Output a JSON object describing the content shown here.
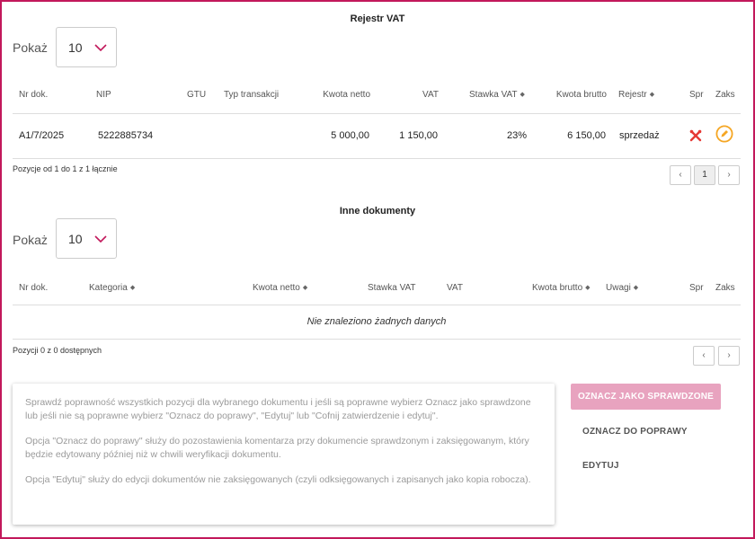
{
  "vat_section": {
    "title": "Rejestr VAT",
    "show_label": "Pokaż",
    "page_size": "10",
    "headers": {
      "nr_dok": "Nr dok.",
      "nip": "NIP",
      "gtu": "GTU",
      "typ_transakcji": "Typ transakcji",
      "kwota_netto": "Kwota netto",
      "vat": "VAT",
      "stawka_vat": "Stawka VAT",
      "kwota_brutto": "Kwota brutto",
      "rejestr": "Rejestr",
      "spr": "Spr",
      "zaks": "Zaks"
    },
    "rows": [
      {
        "nr_dok": "A1/7/2025",
        "nip": "5222885734",
        "gtu": "",
        "typ_transakcji": "",
        "kwota_netto": "5 000,00",
        "vat": "1 150,00",
        "stawka_vat": "23%",
        "kwota_brutto": "6 150,00",
        "rejestr": "sprzedaż"
      }
    ],
    "info": "Pozycje od 1 do 1 z 1 łącznie",
    "pagination": {
      "prev": "‹",
      "current": "1",
      "next": "›"
    }
  },
  "other_section": {
    "title": "Inne dokumenty",
    "show_label": "Pokaż",
    "page_size": "10",
    "headers": {
      "nr_dok": "Nr dok.",
      "kategoria": "Kategoria",
      "kwota_netto": "Kwota netto",
      "stawka_vat": "Stawka VAT",
      "vat": "VAT",
      "kwota_brutto": "Kwota brutto",
      "uwagi": "Uwagi",
      "spr": "Spr",
      "zaks": "Zaks"
    },
    "empty_text": "Nie znaleziono żadnych danych",
    "info": "Pozycji 0 z 0 dostępnych",
    "pagination": {
      "prev": "‹",
      "next": "›"
    }
  },
  "note": {
    "p1": "Sprawdź poprawność wszystkich pozycji dla wybranego dokumentu i jeśli są poprawne wybierz Oznacz jako sprawdzone lub jeśli nie są poprawne wybierz \"Oznacz do poprawy\", \"Edytuj\" lub \"Cofnij zatwierdzenie i edytuj\".",
    "p2": "Opcja \"Oznacz do poprawy\" służy do pozostawienia komentarza przy dokumencie sprawdzonym i zaksięgowanym, który będzie edytowany później niż w chwili weryfikacji dokumentu.",
    "p3": "Opcja \"Edytuj\" służy do edycji dokumentów nie zaksięgowanych (czyli odksięgowanych i zapisanych jako kopia robocza)."
  },
  "actions": {
    "mark_checked": "OZNACZ JAKO SPRAWDZONE",
    "mark_fix": "OZNACZ DO POPRAWY",
    "edit": "EDYTUJ"
  },
  "colors": {
    "frame": "#c2185b",
    "accent_primary_disabled": "#e8a3bf",
    "chevron": "#c2185b",
    "error_icon": "#e53935",
    "edit_icon": "#f5a623"
  },
  "icons": {
    "sort": "sort-icon",
    "spr_status": "tools-cross-icon",
    "zaks_action": "pencil-circle-icon",
    "dropdown": "chevron-down-icon"
  }
}
